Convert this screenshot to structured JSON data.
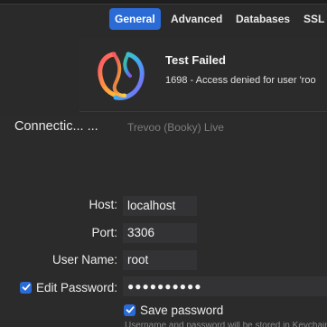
{
  "tabs": [
    {
      "label": "General",
      "active": true
    },
    {
      "label": "Advanced",
      "active": false
    },
    {
      "label": "Databases",
      "active": false
    },
    {
      "label": "SSL",
      "active": false
    }
  ],
  "alert": {
    "title": "Test Failed",
    "message": "1698 - Access denied for user 'roo",
    "icon": "app-logo-icon"
  },
  "form": {
    "connection_label": "Connectic... ...",
    "connection_value": "Trevoo (Booky) Live",
    "host_label": "Host:",
    "host_value": "localhost",
    "port_label": "Port:",
    "port_value": "3306",
    "username_label": "User Name:",
    "username_value": "root",
    "edit_password_label": "Edit Password:",
    "edit_password_checked": true,
    "password_value": "●●●●●●●●●●",
    "save_password_label": "Save password",
    "save_password_checked": true,
    "hint_text": "Username and password will be stored in Keychain"
  },
  "colors": {
    "accent": "#2b6bd6",
    "background": "#2a2a2b",
    "field_bg": "#333335"
  }
}
